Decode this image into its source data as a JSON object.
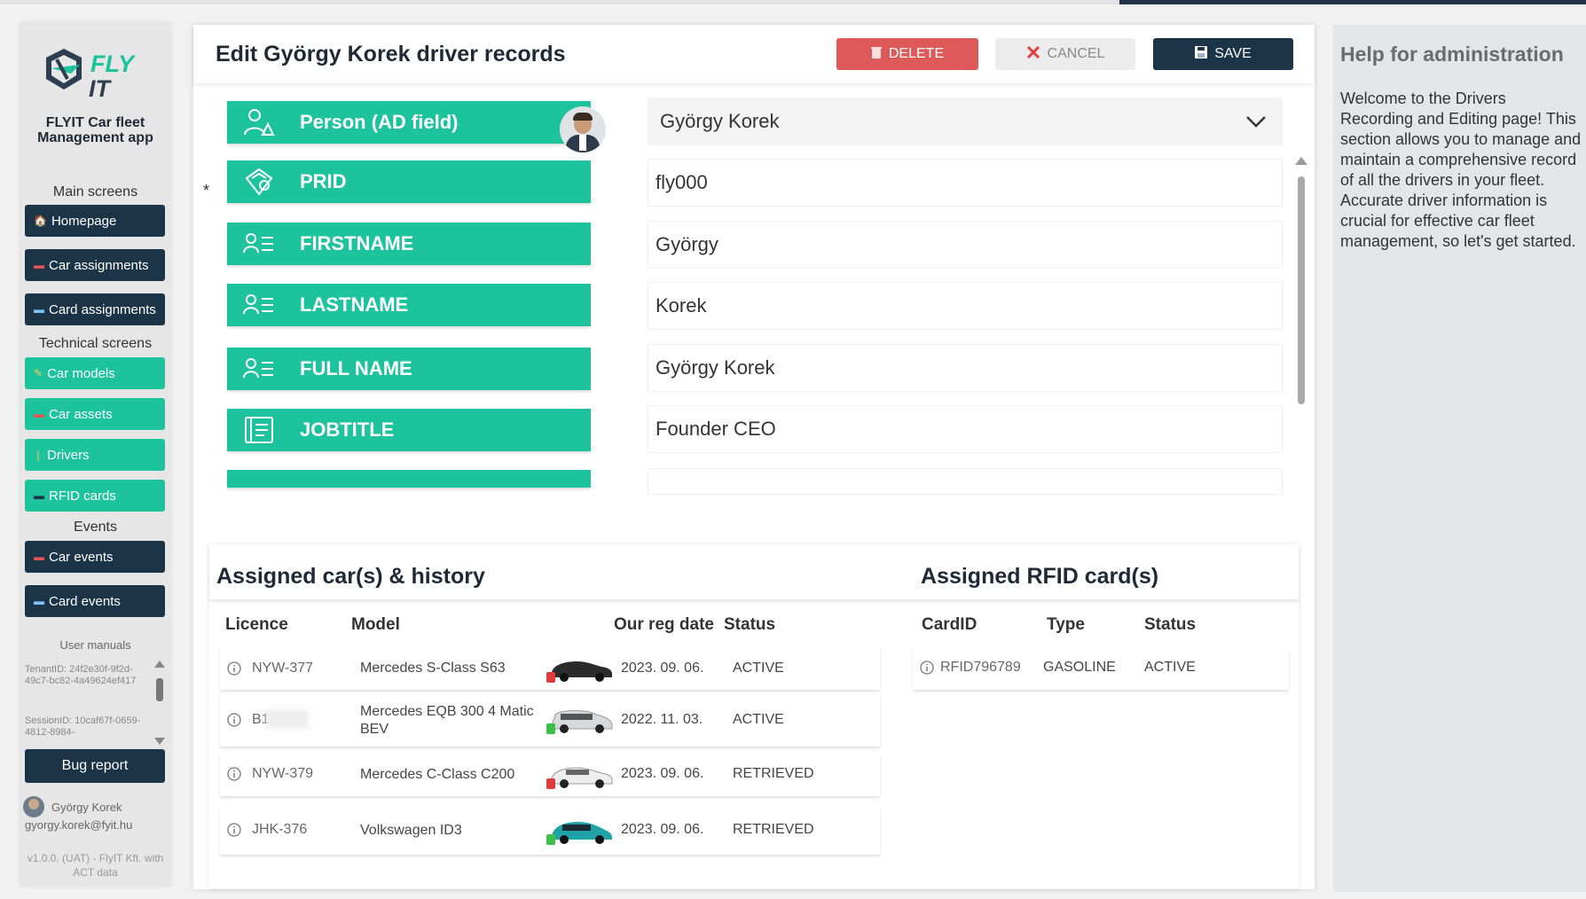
{
  "sidebar": {
    "logo_text_1": "FLY",
    "logo_text_2": "IT",
    "app_name": "FLYIT Car fleet Management app",
    "sections": {
      "main": "Main screens",
      "technical": "Technical screens",
      "events": "Events",
      "manuals": "User manuals"
    },
    "nav": {
      "homepage": "Homepage",
      "car_assignments": "Car assignments",
      "card_assignments": "Card assignments",
      "car_models": "Car models",
      "car_assets": "Car assets",
      "drivers": "Drivers",
      "rfid_cards": "RFID cards",
      "car_events": "Car events",
      "card_events": "Card events"
    },
    "tenant_text": "TenantID: 24f2e30f-9f2d-49c7-bc82-4a49624ef417",
    "session_text": "SessionID: 10caf67f-0659-4812-8984-",
    "bug_report": "Bug report",
    "user_name": "György Korek",
    "user_email": "gyorgy.korek@fyit.hu",
    "version": "v1.0.0. (UAT) - FlyIT Kft. with ACT data"
  },
  "header": {
    "title": "Edit György Korek driver records",
    "delete": "DELETE",
    "cancel": "CANCEL",
    "save": "SAVE"
  },
  "fields": {
    "person": {
      "label": "Person (AD field)",
      "value": "György Korek"
    },
    "prid": {
      "label": "PRID",
      "value": "fly000"
    },
    "firstname": {
      "label": "FIRSTNAME",
      "value": "György"
    },
    "lastname": {
      "label": "LASTNAME",
      "value": "Korek"
    },
    "fullname": {
      "label": "FULL NAME",
      "value": "György Korek"
    },
    "jobtitle": {
      "label": "JOBTITLE",
      "value": "Founder CEO"
    },
    "required_mark": "*"
  },
  "cars": {
    "title": "Assigned car(s) & history",
    "headers": {
      "licence": "Licence",
      "model": "Model",
      "reg_date": "Our reg date",
      "status": "Status"
    },
    "rows": [
      {
        "licence": "NYW-377",
        "model": "Mercedes S-Class S63",
        "date": "2023. 09. 06.",
        "status": "ACTIVE",
        "fuel_color": "#e23b3b",
        "car_color": "#2b2b2b"
      },
      {
        "licence": "B1",
        "model": "Mercedes EQB 300 4 Matic BEV",
        "date": "2022. 11. 03.",
        "status": "ACTIVE",
        "fuel_color": "#3bbf4a",
        "car_color": "#d7d9db"
      },
      {
        "licence": "NYW-379",
        "model": "Mercedes C-Class C200",
        "date": "2023. 09. 06.",
        "status": "RETRIEVED",
        "fuel_color": "#e23b3b",
        "car_color": "#eeeeee"
      },
      {
        "licence": "JHK-376",
        "model": "Volkswagen ID3",
        "date": "2023. 09. 06.",
        "status": "RETRIEVED",
        "fuel_color": "#3bbf4a",
        "car_color": "#1fa3a8"
      }
    ]
  },
  "rfid": {
    "title": "Assigned RFID card(s)",
    "headers": {
      "cardid": "CardID",
      "type": "Type",
      "status": "Status"
    },
    "rows": [
      {
        "cardid": "RFID796789",
        "type": "GASOLINE",
        "status": "ACTIVE"
      }
    ]
  },
  "help": {
    "title": "Help for administration",
    "text": "Welcome to the Drivers Recording and Editing page! This section allows you to manage and maintain a comprehensive record of all the drivers in your fleet. Accurate driver information is crucial for effective car fleet management, so let's get started."
  },
  "colors": {
    "accent_green": "#1dc39d",
    "dark_navy": "#1c3448",
    "delete_red": "#de5a5a"
  }
}
